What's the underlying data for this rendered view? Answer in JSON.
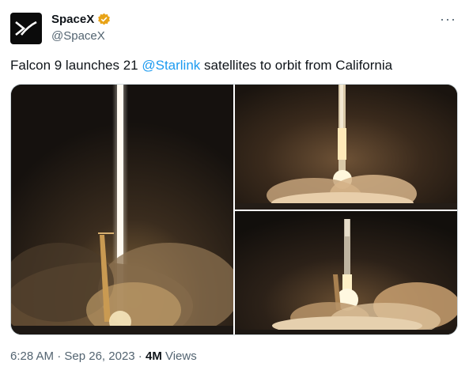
{
  "author": {
    "name": "SpaceX",
    "handle": "@SpaceX",
    "avatar_icon": "spacex-x-logo-icon",
    "verified_icon": "verified-badge-icon",
    "verified_color": "#e8a317"
  },
  "menu": {
    "more_label": "···"
  },
  "tweet": {
    "text_before": "Falcon 9 launches 21 ",
    "mention": "@Starlink",
    "text_after": " satellites to orbit from California"
  },
  "media": {
    "photos": [
      {
        "icon": "rocket-launch-photo"
      },
      {
        "icon": "rocket-launch-photo"
      },
      {
        "icon": "rocket-launch-photo"
      }
    ]
  },
  "meta": {
    "time": "6:28 AM",
    "sep1": " · ",
    "date": "Sep 26, 2023",
    "sep2": " · ",
    "views_count": "4M",
    "views_label": " Views"
  },
  "colors": {
    "mention": "#1d9bf0",
    "secondary_text": "#536471",
    "primary_text": "#0f1419"
  }
}
